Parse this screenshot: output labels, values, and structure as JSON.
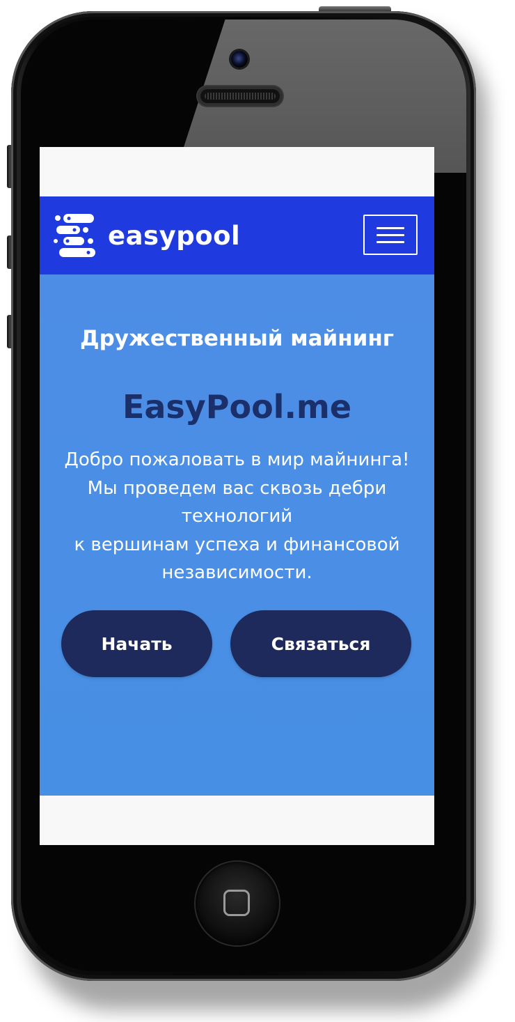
{
  "brand": {
    "name": "easypool",
    "logo_icon": "easypool-logo-icon",
    "nav_color": "#1f3be0"
  },
  "navbar": {
    "menu_icon": "hamburger-menu-icon"
  },
  "hero": {
    "subtitle": "Дружественный майнинг",
    "title": "EasyPool.me",
    "text_lines": [
      "Добро пожаловать в мир майнинга!",
      "Мы проведем вас сквозь дебри",
      "технологий",
      "к вершинам успеха и финансовой",
      "независимости."
    ],
    "background_color": "#4a8fe5",
    "title_color": "#1b2f6b"
  },
  "buttons": {
    "start_label": "Начать",
    "contact_label": "Связаться",
    "button_color": "#1d2a5b"
  },
  "device": {
    "home_button_icon": "home-button-icon",
    "camera_icon": "front-camera-icon",
    "speaker_icon": "earpiece-speaker-icon"
  }
}
